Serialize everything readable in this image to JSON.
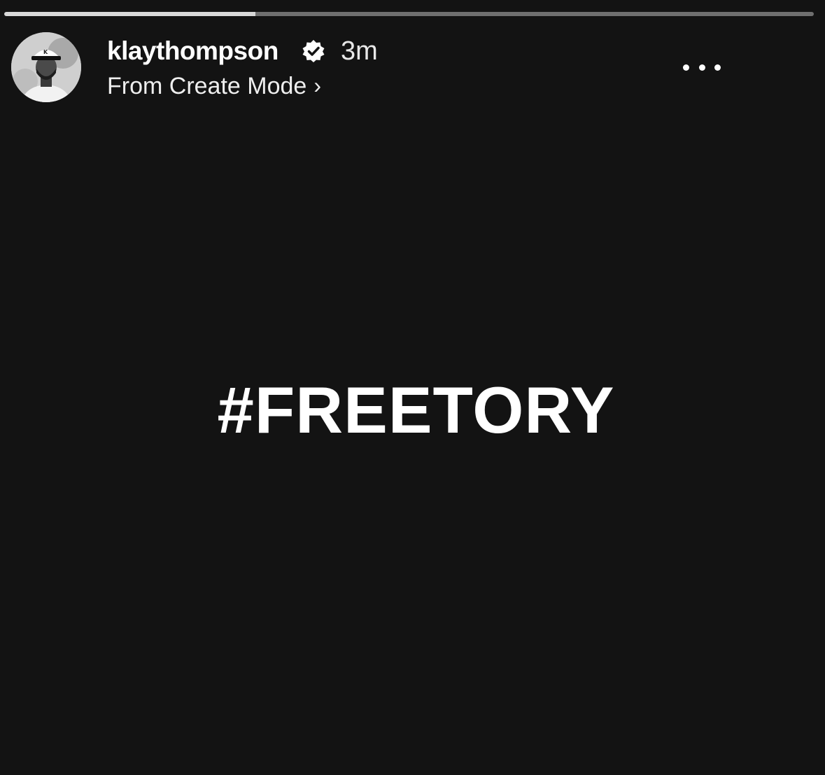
{
  "story": {
    "progress_fraction": 0.31,
    "username": "klaythompson",
    "verified": true,
    "time_ago": "3m",
    "subtitle": "From Create Mode",
    "text": "#FREETORY"
  },
  "icons": {
    "avatar": "profile-photo",
    "verified": "verified-badge-icon",
    "subtitle_chevron": "chevron-right-icon",
    "more": "more-options-icon"
  },
  "colors": {
    "background": "#131313",
    "text": "#ffffff",
    "progress_track": "#6f6f6f",
    "progress_fill": "#d9d9d9"
  }
}
